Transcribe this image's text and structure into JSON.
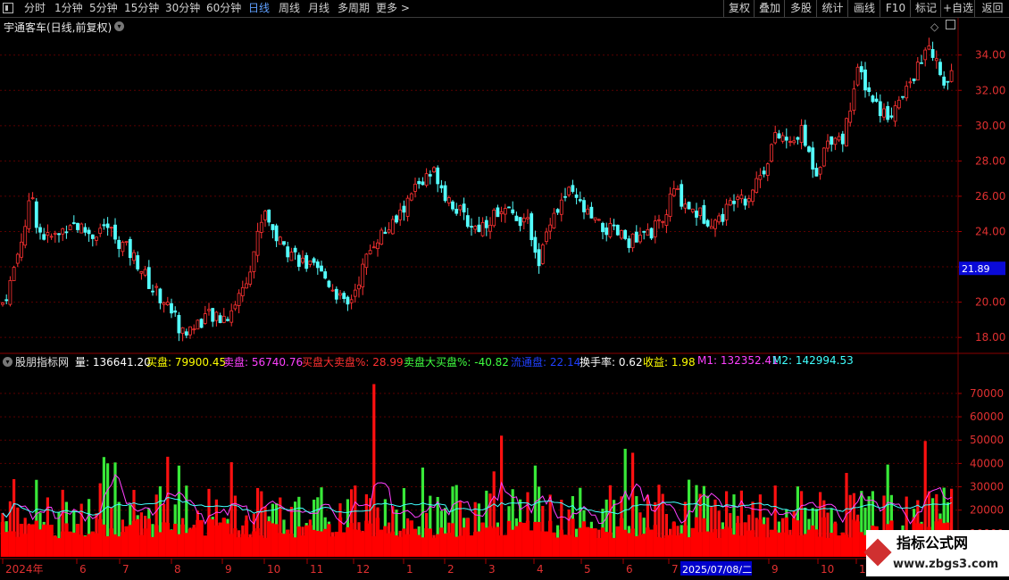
{
  "toolbar": {
    "menu_icon": "menu-icon",
    "tabs": [
      "分时",
      "1分钟",
      "5分钟",
      "15分钟",
      "30分钟",
      "60分钟",
      "日线",
      "周线",
      "月线",
      "多周期",
      "更多 >"
    ],
    "active_tab": "日线",
    "right_buttons": [
      "复权",
      "叠加",
      "多股",
      "统计",
      "画线",
      "F10",
      "标记",
      "+自选",
      "返回"
    ]
  },
  "main_chart": {
    "title": "宇通客车(日线,前复权)",
    "price_axis": [
      "34.00",
      "32.00",
      "30.00",
      "28.00",
      "26.00",
      "24.00",
      "22.00",
      "20.00",
      "18.00"
    ],
    "price_marker": "21.89",
    "ylim": [
      17.2,
      35.4
    ],
    "colors": {
      "up": "#ff3232",
      "down": "#54ffff",
      "grid": "#5a0000",
      "axis_text": "#e03030",
      "marker_bg": "#0a0ad8"
    }
  },
  "indicator": {
    "name": "股朋指标网",
    "readouts": [
      {
        "label": "量:",
        "value": "136641.20",
        "color": "#ffffff"
      },
      {
        "label": "买盘:",
        "value": "79900.45",
        "color": "#ffff00"
      },
      {
        "label": "卖盘:",
        "value": "56740.76",
        "color": "#ff40ff"
      },
      {
        "label": "买盘大卖盘%:",
        "value": "28.99",
        "color": "#ff3030"
      },
      {
        "label": "卖盘大买盘%:",
        "value": "-40.82",
        "color": "#40ff40"
      },
      {
        "label": "流通盘:",
        "value": "22.14",
        "color": "#2040ff"
      },
      {
        "label": "换手率:",
        "value": "0.62",
        "color": "#ffffff"
      },
      {
        "label": "收益:",
        "value": "1.98",
        "color": "#ffff00"
      },
      {
        "label": "M1:",
        "value": "132352.41",
        "color": "#ff40ff"
      },
      {
        "label": "M2:",
        "value": "142994.53",
        "color": "#40ffff"
      }
    ],
    "volume_axis": [
      "70000",
      "60000",
      "50000",
      "40000",
      "30000",
      "20000",
      "10000"
    ],
    "ylim": [
      0,
      78000
    ]
  },
  "date_axis": {
    "labels": [
      "2024年",
      "6",
      "7",
      "8",
      "9",
      "10",
      "11",
      "12",
      "1",
      "2",
      "3",
      "4",
      "5",
      "6",
      "7",
      "9",
      "10",
      "11"
    ],
    "cursor_date": "2025/07/08/二"
  },
  "watermark": {
    "title": "指标公式网",
    "url": "www.zbgs3.com"
  },
  "chart_data": {
    "type": "candlestick",
    "security": "宇通客车",
    "period": "daily, forward-adjusted",
    "price_range": [
      17.2,
      35.4
    ],
    "close_path_approx": [
      [
        0,
        19.6
      ],
      [
        10,
        20.8
      ],
      [
        20,
        22.8
      ],
      [
        30,
        24.8
      ],
      [
        36,
        26.2
      ],
      [
        42,
        24.2
      ],
      [
        52,
        23.6
      ],
      [
        66,
        23.8
      ],
      [
        78,
        24.6
      ],
      [
        90,
        24.2
      ],
      [
        104,
        23.8
      ],
      [
        118,
        24.4
      ],
      [
        130,
        23.6
      ],
      [
        142,
        23.0
      ],
      [
        155,
        22.2
      ],
      [
        170,
        20.8
      ],
      [
        182,
        20.2
      ],
      [
        194,
        19.4
      ],
      [
        204,
        18.2
      ],
      [
        216,
        18.6
      ],
      [
        230,
        19.2
      ],
      [
        244,
        19.0
      ],
      [
        256,
        19.3
      ],
      [
        266,
        20.2
      ],
      [
        276,
        21.4
      ],
      [
        286,
        23.2
      ],
      [
        296,
        25.4
      ],
      [
        306,
        24.0
      ],
      [
        316,
        23.2
      ],
      [
        328,
        22.8
      ],
      [
        340,
        22.2
      ],
      [
        352,
        21.8
      ],
      [
        364,
        21.4
      ],
      [
        376,
        20.6
      ],
      [
        388,
        19.6
      ],
      [
        398,
        20.8
      ],
      [
        410,
        22.4
      ],
      [
        420,
        23.6
      ],
      [
        432,
        24.0
      ],
      [
        444,
        24.6
      ],
      [
        456,
        25.6
      ],
      [
        466,
        26.6
      ],
      [
        478,
        27.0
      ],
      [
        488,
        27.4
      ],
      [
        498,
        26.2
      ],
      [
        510,
        25.4
      ],
      [
        522,
        24.6
      ],
      [
        534,
        24.2
      ],
      [
        546,
        24.6
      ],
      [
        558,
        25.2
      ],
      [
        570,
        25.0
      ],
      [
        582,
        24.8
      ],
      [
        594,
        24.2
      ],
      [
        604,
        22.2
      ],
      [
        616,
        24.8
      ],
      [
        626,
        25.4
      ],
      [
        636,
        26.2
      ],
      [
        648,
        25.6
      ],
      [
        660,
        24.8
      ],
      [
        672,
        24.2
      ],
      [
        686,
        24.0
      ],
      [
        700,
        23.6
      ],
      [
        714,
        23.4
      ],
      [
        728,
        24.0
      ],
      [
        742,
        24.4
      ],
      [
        754,
        26.4
      ],
      [
        764,
        25.8
      ],
      [
        776,
        25.2
      ],
      [
        790,
        24.8
      ],
      [
        804,
        24.6
      ],
      [
        816,
        25.4
      ],
      [
        826,
        26.4
      ],
      [
        836,
        25.8
      ],
      [
        846,
        26.8
      ],
      [
        856,
        27.6
      ],
      [
        866,
        29.2
      ],
      [
        876,
        29.4
      ],
      [
        886,
        28.8
      ],
      [
        896,
        29.8
      ],
      [
        906,
        28.4
      ],
      [
        914,
        27.4
      ],
      [
        924,
        28.8
      ],
      [
        934,
        29.6
      ],
      [
        944,
        29.2
      ],
      [
        952,
        31.2
      ],
      [
        962,
        33.2
      ],
      [
        972,
        32.0
      ],
      [
        982,
        31.2
      ],
      [
        992,
        30.6
      ],
      [
        1002,
        31.0
      ],
      [
        1012,
        31.6
      ],
      [
        1022,
        32.8
      ],
      [
        1032,
        33.6
      ],
      [
        1040,
        34.6
      ],
      [
        1050,
        33.4
      ],
      [
        1060,
        32.4
      ],
      [
        1068,
        32.8
      ]
    ],
    "volume_range": [
      0,
      78000
    ],
    "volume_note": "daily volume bars, red=up, green=down, with M1 (magenta) and M2 (cyan) moving averages"
  }
}
